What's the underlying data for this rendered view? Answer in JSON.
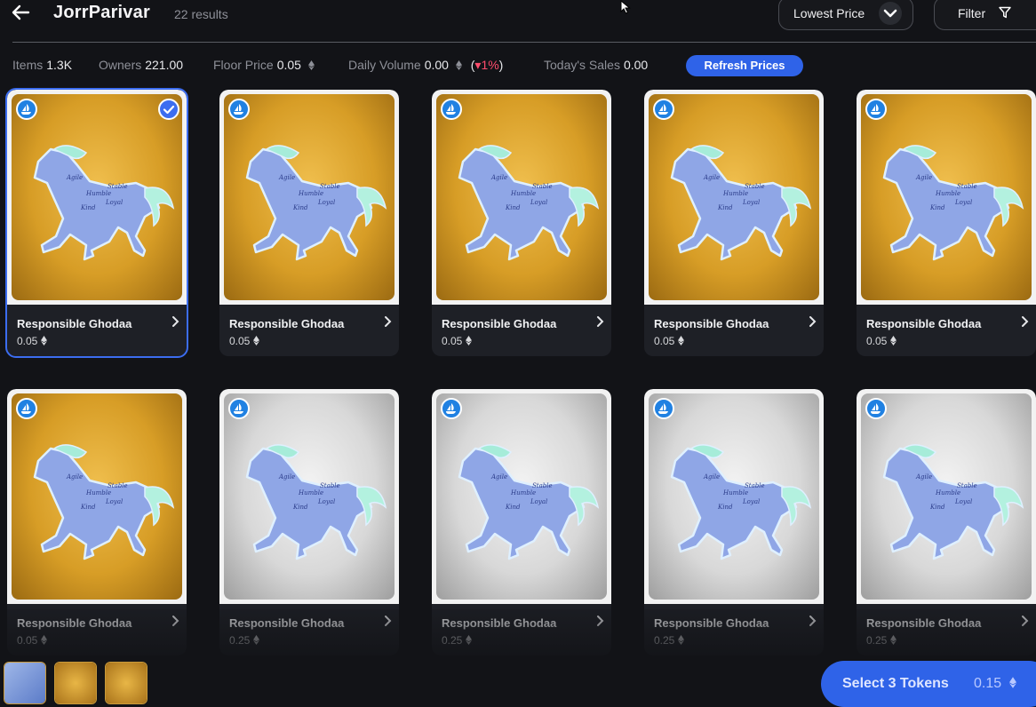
{
  "header": {
    "back_icon": "arrow-left-icon",
    "title": "JorrParivar",
    "results": "22 results",
    "sort_label": "Lowest Price",
    "sort_icon": "chevron-down-icon",
    "filter_label": "Filter",
    "filter_icon": "funnel-icon"
  },
  "stats": {
    "items_label": "Items",
    "items_value": "1.3K",
    "owners_label": "Owners",
    "owners_value": "221.00",
    "floor_label": "Floor Price",
    "floor_value": "0.05",
    "volume_label": "Daily Volume",
    "volume_value": "0.00",
    "volume_change_open": "(",
    "volume_change_arrow": "▾",
    "volume_change": "1%",
    "volume_change_close": ")",
    "sales_label": "Today's Sales",
    "sales_value": "0.00",
    "refresh_label": "Refresh Prices"
  },
  "colors": {
    "accent": "#2f63e8",
    "negative": "#ff4d6d",
    "background": "#121317",
    "card": "#1e2026"
  },
  "cards": [
    {
      "name": "Responsible Ghodaa",
      "price": "0.05",
      "art": "gold",
      "selected": true
    },
    {
      "name": "Responsible Ghodaa",
      "price": "0.05",
      "art": "gold",
      "selected": false
    },
    {
      "name": "Responsible Ghodaa",
      "price": "0.05",
      "art": "gold",
      "selected": false
    },
    {
      "name": "Responsible Ghodaa",
      "price": "0.05",
      "art": "gold",
      "selected": false
    },
    {
      "name": "Responsible Ghodaa",
      "price": "0.05",
      "art": "gold",
      "selected": false
    },
    {
      "name": "Responsible Ghodaa",
      "price": "0.05",
      "art": "gold",
      "selected": false
    },
    {
      "name": "Responsible Ghodaa",
      "price": "0.25",
      "art": "silver",
      "selected": false
    },
    {
      "name": "Responsible Ghodaa",
      "price": "0.25",
      "art": "silver",
      "selected": false
    },
    {
      "name": "Responsible Ghodaa",
      "price": "0.25",
      "art": "silver",
      "selected": false
    },
    {
      "name": "Responsible Ghodaa",
      "price": "0.25",
      "art": "silver",
      "selected": false
    }
  ],
  "footer": {
    "select_label": "Select 3 Tokens",
    "select_total": "0.15",
    "thumbnails": [
      "horse-thumbnail",
      "horse-thumbnail",
      "horse-thumbnail"
    ]
  }
}
